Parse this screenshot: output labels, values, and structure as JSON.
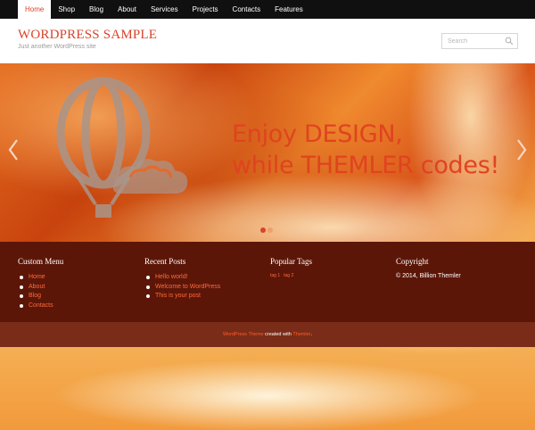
{
  "nav": {
    "items": [
      "Home",
      "Shop",
      "Blog",
      "About",
      "Services",
      "Projects",
      "Contacts",
      "Features"
    ],
    "active": "Home"
  },
  "header": {
    "title": "WORDPRESS SAMPLE",
    "tagline": "Just another WordPress site",
    "search_placeholder": "Search"
  },
  "slider": {
    "line1": "Enjoy DESIGN,",
    "line2": "while THEMLER codes!",
    "dots": 2,
    "active_dot": 1
  },
  "footer": {
    "custom_menu": {
      "title": "Custom Menu",
      "items": [
        "Home",
        "About",
        "Blog",
        "Contacts"
      ]
    },
    "recent_posts": {
      "title": "Recent Posts",
      "items": [
        "Hello world!",
        "Welcome to WordPress",
        "This is your post"
      ]
    },
    "popular_tags": {
      "title": "Popular Tags",
      "tags": [
        "tag 1",
        "tag 2"
      ]
    },
    "copyright": {
      "title": "Copyright",
      "text": "© 2014, Billion Themler"
    }
  },
  "bottom_bar": {
    "link1": "WordPress Theme",
    "middle": " created with ",
    "link2": "Themler",
    "end": "."
  },
  "colors": {
    "accent": "#d8432a",
    "nav_bg": "#101010",
    "footer_bg": "#5c1608",
    "bottom_bg": "#7a2c18",
    "link": "#ff6a3c"
  }
}
